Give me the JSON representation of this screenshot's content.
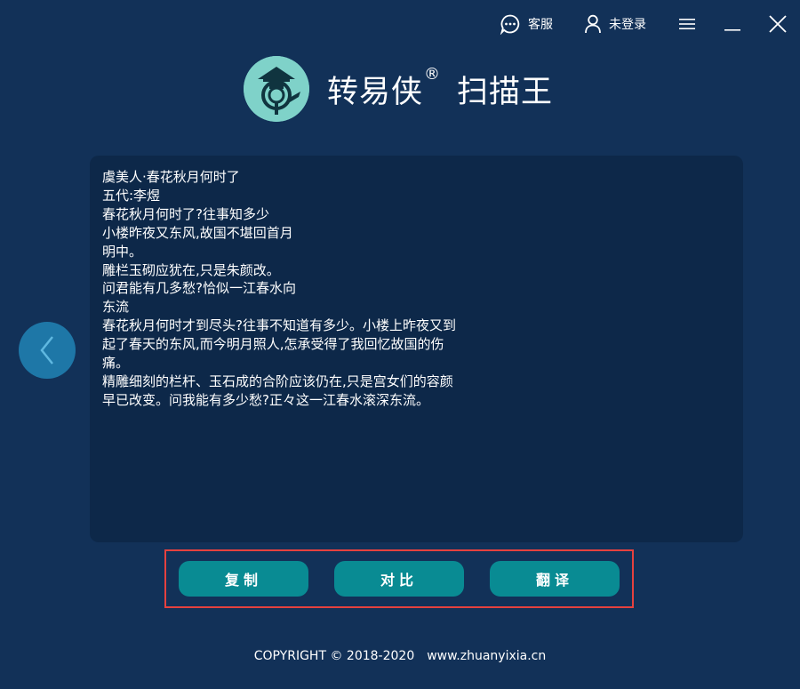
{
  "topbar": {
    "service_label": "客服",
    "login_label": "未登录"
  },
  "brand": {
    "name": "转易侠",
    "registered": "®",
    "product": "扫描王"
  },
  "result_text": "虞美人·春花秋月何时了\n五代:李煜\n春花秋月何时了?往事知多少\n小楼昨夜又东风,故国不堪回首月\n明中。\n雕栏玉砌应犹在,只是朱颜改。\n问君能有几多愁?恰似一江春水向\n东流\n春花秋月何时才到尽头?往事不知道有多少。小楼上昨夜又到起了春天的东风,而今明月照人,怎承受得了我回忆故国的伤痛。\n精雕细刻的栏杆、玉石成的合阶应该仍在,只是宫女们的容颜早已改变。问我能有多少愁?正々这一江春水滚深东流。",
  "actions": {
    "copy": "复制",
    "compare": "对比",
    "translate": "翻译"
  },
  "footer": {
    "copyright": "COPYRIGHT © 2018-2020",
    "site": "www.zhuanyixia.cn"
  },
  "colors": {
    "background": "#123158",
    "panel": "#0d2849",
    "button": "#098b93",
    "highlight_frame": "#e5413f",
    "back_button": "#1e77a7",
    "logo": "#7fd2c9"
  },
  "icons": [
    "chat-icon",
    "user-icon",
    "menu-icon",
    "minimize-icon",
    "close-icon",
    "chevron-left-icon",
    "logo-icon"
  ]
}
